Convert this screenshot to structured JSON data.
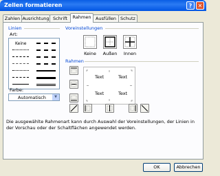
{
  "window": {
    "title": "Zellen formatieren",
    "help": "?",
    "close": "✕"
  },
  "tabs": [
    {
      "label": "Zahlen",
      "active": false
    },
    {
      "label": "Ausrichtung",
      "active": false
    },
    {
      "label": "Schrift",
      "active": false
    },
    {
      "label": "Rahmen",
      "active": true
    },
    {
      "label": "Ausfüllen",
      "active": false
    },
    {
      "label": "Schutz",
      "active": false
    }
  ],
  "linien": {
    "group_label": "Linien",
    "art_label": "Art:",
    "keine": "Keine",
    "farbe_label": "Farbe:",
    "farbe_value": "Automatisch"
  },
  "voreinstellungen": {
    "group_label": "Voreinstellungen",
    "items": [
      {
        "label": "Keine"
      },
      {
        "label": "Außen"
      },
      {
        "label": "Innen"
      }
    ]
  },
  "rahmen": {
    "group_label": "Rahmen",
    "preview_text": [
      "Text",
      "Text",
      "Text",
      "Text"
    ]
  },
  "description": "Die ausgewählte Rahmenart kann durch Auswahl der Voreinstellungen, der Linien in der Vorschau oder der Schaltflächen angewendet werden.",
  "buttons": {
    "ok": "OK",
    "cancel": "Abbrechen"
  }
}
